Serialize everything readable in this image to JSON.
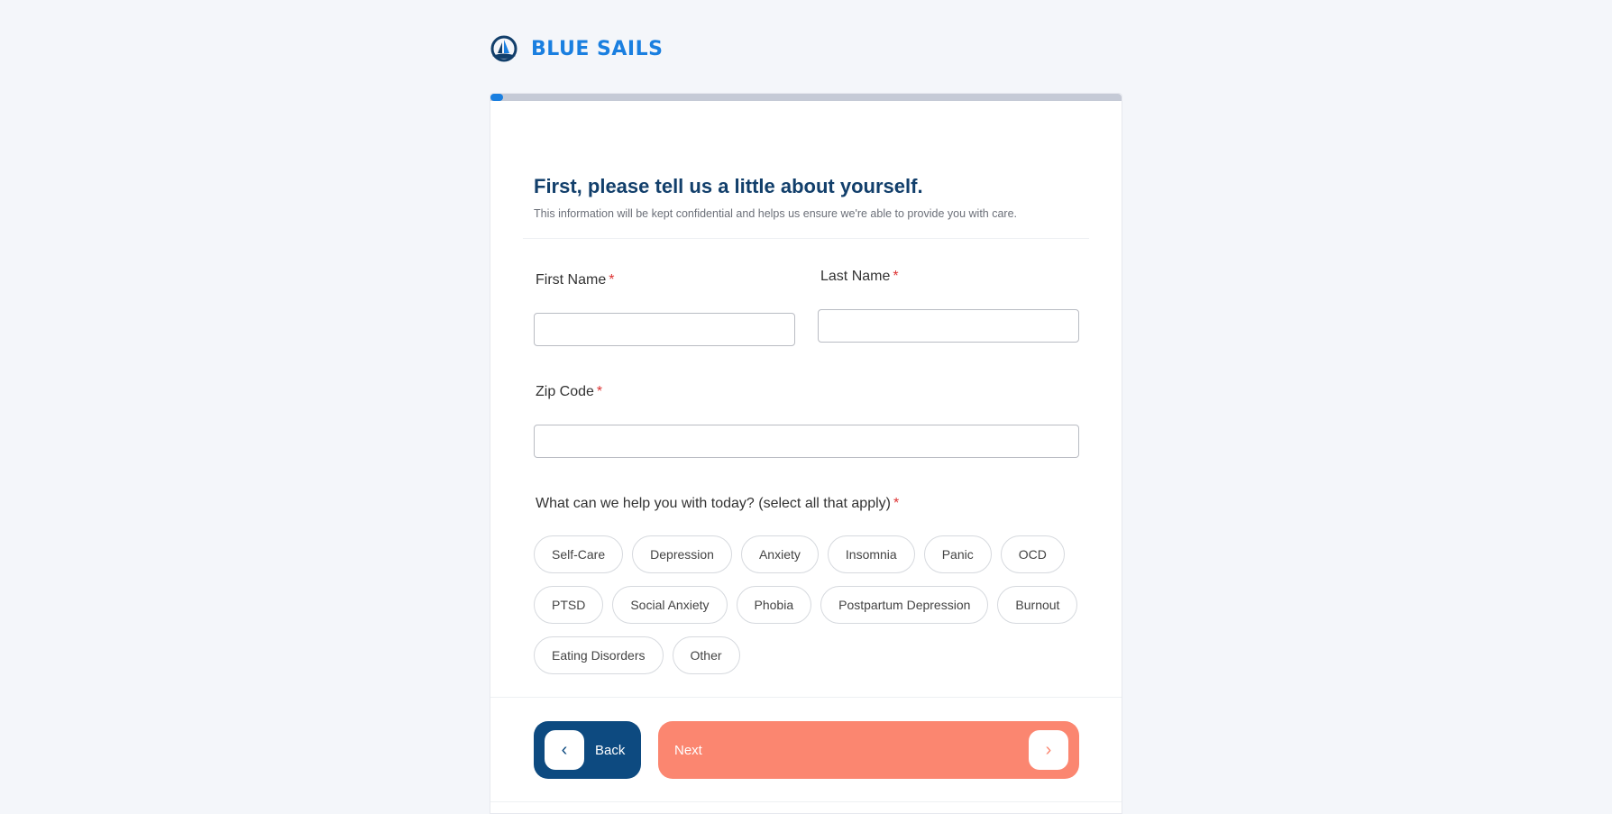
{
  "brand": {
    "name": "BLUE SAILS",
    "icon": "sailboat-logo",
    "color": "#1a7fe0"
  },
  "progress": {
    "percent": 2,
    "fill_color": "#1a7fe0"
  },
  "form": {
    "title": "First, please tell us a little about yourself.",
    "subtitle": "This information will be kept confidential and helps us ensure we're able to provide you with care.",
    "required_mark": "*",
    "first_name": {
      "label": "First Name",
      "value": ""
    },
    "last_name": {
      "label": "Last Name",
      "value": ""
    },
    "zip": {
      "label": "Zip Code",
      "value": ""
    },
    "question": "What can we help you with today? (select all that apply)",
    "options": [
      "Self-Care",
      "Depression",
      "Anxiety",
      "Insomnia",
      "Panic",
      "OCD",
      "PTSD",
      "Social Anxiety",
      "Phobia",
      "Postpartum Depression",
      "Burnout",
      "Eating Disorders",
      "Other"
    ]
  },
  "nav": {
    "back_label": "Back",
    "next_label": "Next",
    "back_color": "#0d4a80",
    "next_color": "#fb8670"
  }
}
